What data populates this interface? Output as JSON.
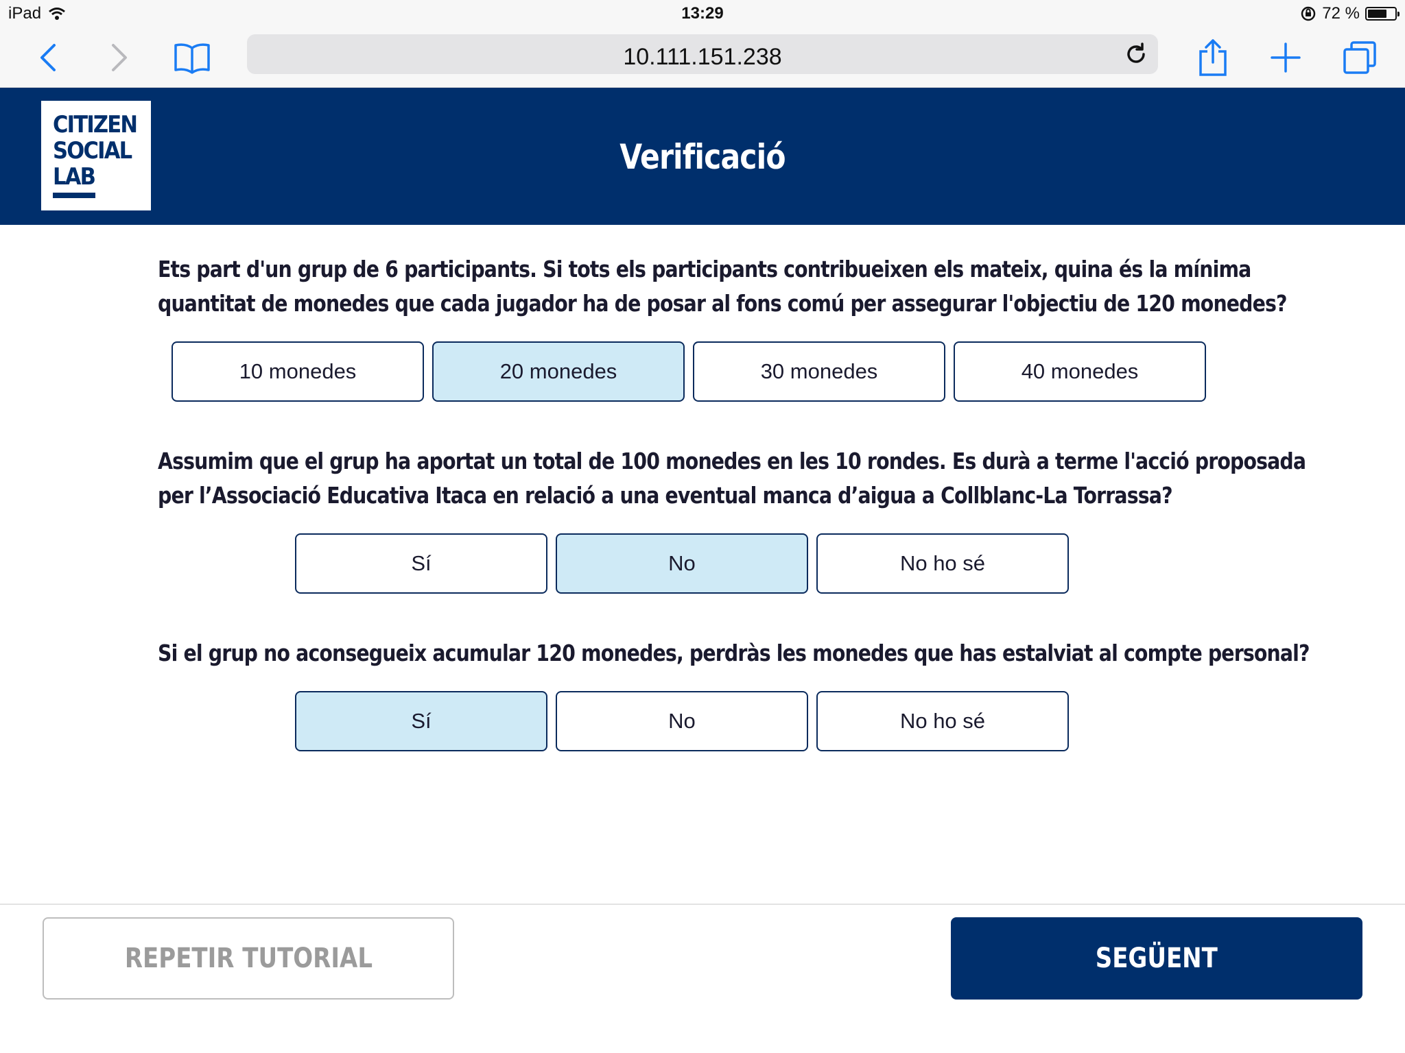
{
  "status_bar": {
    "device": "iPad",
    "time": "13:29",
    "battery": "72 %",
    "battery_level": 0.72,
    "icons": [
      "wifi-icon",
      "rotation-lock-icon",
      "battery-icon"
    ]
  },
  "browser": {
    "url": "10.111.151.238",
    "icons": [
      "back-icon",
      "forward-icon",
      "bookmarks-icon",
      "reload-icon",
      "share-icon",
      "new-tab-icon",
      "tabs-icon"
    ]
  },
  "header": {
    "logo_lines": [
      "CITIZEN",
      "SOCIAL",
      "LAB"
    ],
    "title": "Verificació"
  },
  "questions": [
    {
      "lines": [
        "Ets part d'un grup de 6 participants. Si tots els participants contribueixen els mateix, quina és la mínima",
        "quantitat de monedes que cada jugador ha de posar al fons comú per assegurar l'objectiu de 120 monedes?"
      ],
      "options": [
        "10 monedes",
        "20 monedes",
        "30 monedes",
        "40 monedes"
      ],
      "selected": 1
    },
    {
      "lines": [
        "Assumim que el grup ha aportat un total de 100 monedes en les 10 rondes. Es durà a terme l'acció proposada",
        "per l’Associació Educativa Itaca en relació a una eventual manca d’aigua a Collblanc-La Torrassa?"
      ],
      "options": [
        "Sí",
        "No",
        "No ho sé"
      ],
      "selected": 1
    },
    {
      "lines": [
        "Si el grup no aconsegueix acumular 120 monedes, perdràs les monedes que has estalviat al compte personal?"
      ],
      "options": [
        "Sí",
        "No",
        "No ho sé"
      ],
      "selected": 0
    }
  ],
  "footer": {
    "repeat_label": "REPETIR TUTORIAL",
    "next_label": "SEGÜENT"
  },
  "colors": {
    "brand_navy": "#002f6c",
    "selected_option": "#cfeaf6",
    "ios_blue": "#1a7cf4"
  }
}
